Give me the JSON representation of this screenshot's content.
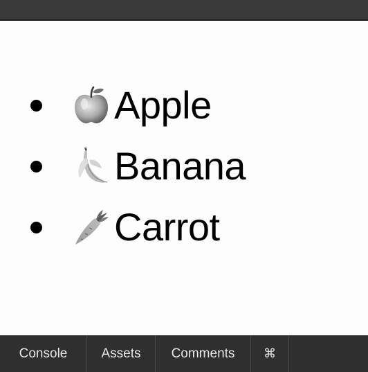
{
  "list": {
    "items": [
      {
        "label": "Apple",
        "icon": "apple-icon"
      },
      {
        "label": "Banana",
        "icon": "banana-icon"
      },
      {
        "label": "Carrot",
        "icon": "carrot-icon"
      }
    ]
  },
  "bottom_tabs": {
    "console": "Console",
    "assets": "Assets",
    "comments": "Comments",
    "command": "⌘"
  },
  "colors": {
    "top_bar": "#3a3a3a",
    "bottom_bar": "#2f2f2f",
    "page_background": "#fdfdfd",
    "text": "#000000"
  }
}
